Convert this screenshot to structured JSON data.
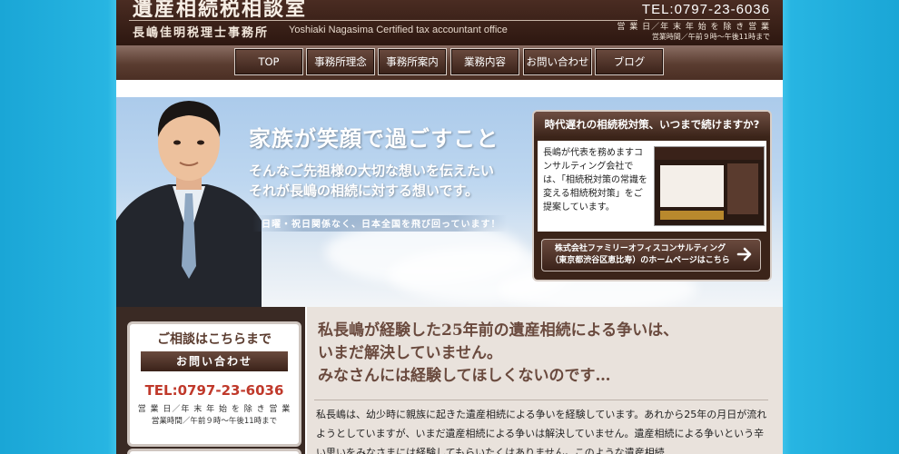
{
  "header": {
    "title": "遺産相続税相談室",
    "office_name_jp": "長嶋佳明税理士事務所",
    "office_name_en": "Yoshiaki Nagasima Certified tax accountant office",
    "tel": "TEL:0797-23-6036",
    "hours_days": "営 業 日／年 末 年 始 を 除 き 営 業",
    "hours_time": "営業時間／午前９時〜午後11時まで"
  },
  "nav": [
    {
      "label": "TOP"
    },
    {
      "label": "事務所理念"
    },
    {
      "label": "事務所案内"
    },
    {
      "label": "業務内容"
    },
    {
      "label": "お問い合わせ"
    },
    {
      "label": "ブログ"
    }
  ],
  "hero": {
    "title": "家族が笑顔で過ごすこと",
    "sub1": "そんなご先祖様の大切な想いを伝えたい",
    "sub2": "それが長嶋の相続に対する想いです。",
    "band": "日曜・祝日関係なく、日本全国を飛び回っています！"
  },
  "promo": {
    "heading": "時代遅れの相続税対策、いつまで続けますか?",
    "text": "長嶋が代表を務めますコンサルティング会社では、「相続税対策の常識を変える相続税対策」をご提案しています。",
    "link_line1": "株式会社ファミリーオフィスコンサルティング",
    "link_line2": "（東京都渋谷区恵比寿）のホームページはこちら"
  },
  "contact": {
    "title": "ご相談はこちらまで",
    "button": "お問い合わせ",
    "tel": "TEL:0797-23-6036",
    "hours_days": "営 業 日／年 末 年 始 を 除 き 営 業",
    "hours_time": "営業時間／午前９時〜午後11時まで"
  },
  "main": {
    "lead1": "私長嶋が経験した25年前の遺産相続による争いは、",
    "lead2": "いまだ解決していません。",
    "lead3": "みなさんには経験してほしくないのです…",
    "body": "私長嶋は、幼少時に親族に起きた遺産相続による争いを経験しています。あれから25年の月日が流れようとしていますが、いまだ遺産相続による争いは解決していません。遺産相続による争いという辛い思いをみなさまには経験してもらいたくはありません。このような遺産相続"
  }
}
